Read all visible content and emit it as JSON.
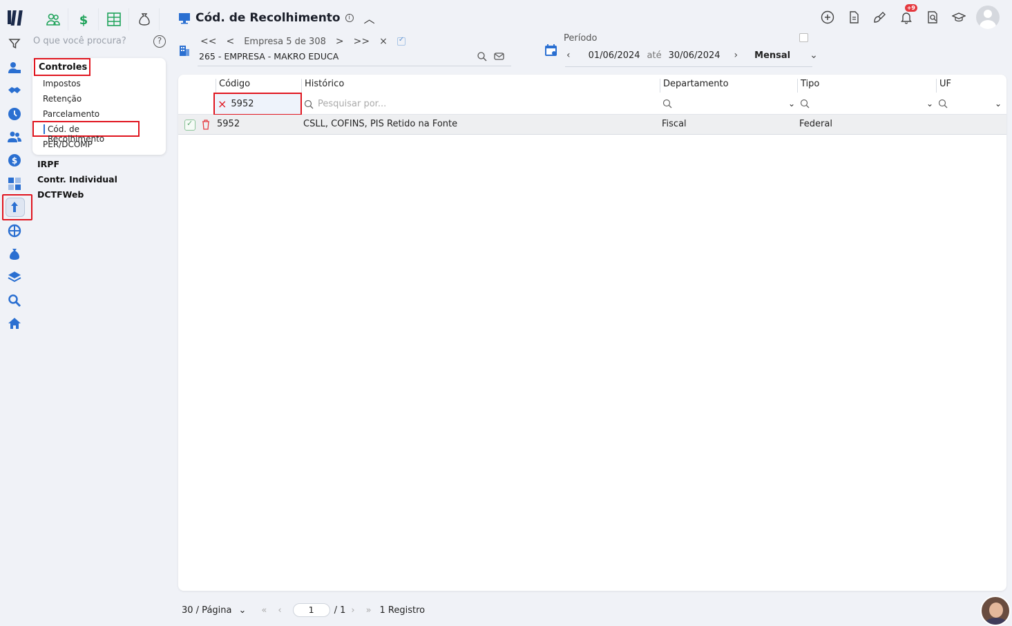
{
  "search": {
    "placeholder": "O que você procura?",
    "help": "?"
  },
  "menu": {
    "heading": "Controles",
    "items": [
      "Impostos",
      "Retenção",
      "Parcelamento",
      "Cód. de Recolhimento",
      "PER/DCOMP"
    ],
    "sections": [
      "IRPF",
      "Contr. Individual",
      "DCTFWeb"
    ]
  },
  "header": {
    "title": "Cód. de Recolhimento",
    "info": "i",
    "notif_badge": "+9"
  },
  "company": {
    "first": "<<",
    "prev": "<",
    "counter": "Empresa 5 de 308",
    "next": ">",
    "last": ">>",
    "clear": "×",
    "name": "265 - EMPRESA - MAKRO EDUCA"
  },
  "period": {
    "label": "Período",
    "start": "01/06/2024",
    "until": "até",
    "end": "30/06/2024",
    "mode": "Mensal"
  },
  "grid": {
    "columns": [
      "Código",
      "Histórico",
      "Departamento",
      "Tipo",
      "UF"
    ],
    "filter_code": "5952",
    "filter_placeholder": "Pesquisar por...",
    "rows": [
      {
        "codigo": "5952",
        "historico": "CSLL, COFINS, PIS Retido na Fonte",
        "departamento": "Fiscal",
        "tipo": "Federal",
        "uf": ""
      }
    ]
  },
  "footer": {
    "per_page": "30 / Página",
    "page": "1",
    "total_pages": "/ 1",
    "records": "1 Registro"
  },
  "colors": {
    "accent": "#2a6fd1",
    "highlight": "#e0141e",
    "green": "#1fa35a"
  }
}
